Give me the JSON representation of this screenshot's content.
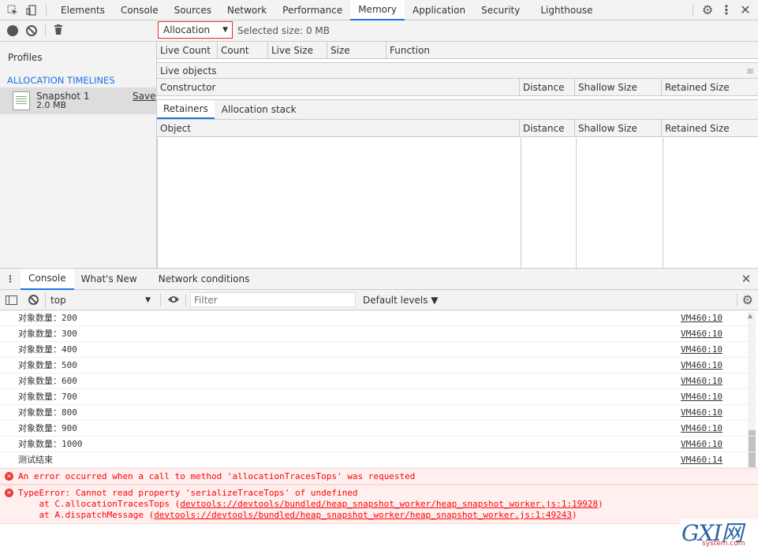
{
  "tabs": [
    "Elements",
    "Console",
    "Sources",
    "Network",
    "Performance",
    "Memory",
    "Application",
    "Security",
    "Lighthouse"
  ],
  "active_tab": "Memory",
  "memory_toolbar": {
    "dropdown": "Allocation",
    "selected_size": "Selected size: 0 MB"
  },
  "sidebar": {
    "profiles_label": "Profiles",
    "section": "ALLOCATION TIMELINES",
    "snapshot_name": "Snapshot 1",
    "snapshot_size": "2.0 MB",
    "save_label": "Save"
  },
  "top_grid": {
    "columns": [
      "Live Count",
      "Count",
      "Live Size",
      "Size",
      "Function"
    ]
  },
  "live_objects": {
    "title": "Live objects",
    "columns": [
      "Constructor",
      "Distance",
      "Shallow Size",
      "Retained Size"
    ]
  },
  "retainers": {
    "tabs": [
      "Retainers",
      "Allocation stack"
    ],
    "columns": [
      "Object",
      "Distance",
      "Shallow Size",
      "Retained Size"
    ]
  },
  "drawer": {
    "tabs": [
      "Console",
      "What's New",
      "Network conditions"
    ]
  },
  "console_toolbar": {
    "context": "top",
    "filter_placeholder": "Filter",
    "levels": "Default levels ▼"
  },
  "messages": [
    {
      "text": "对象数量：200",
      "src": "VM460:10"
    },
    {
      "text": "对象数量：300",
      "src": "VM460:10"
    },
    {
      "text": "对象数量：400",
      "src": "VM460:10"
    },
    {
      "text": "对象数量：500",
      "src": "VM460:10"
    },
    {
      "text": "对象数量：600",
      "src": "VM460:10"
    },
    {
      "text": "对象数量：700",
      "src": "VM460:10"
    },
    {
      "text": "对象数量：800",
      "src": "VM460:10"
    },
    {
      "text": "对象数量：900",
      "src": "VM460:10"
    },
    {
      "text": "对象数量：1000",
      "src": "VM460:10"
    },
    {
      "text": "测试结束",
      "src": "VM460:14"
    }
  ],
  "errors": {
    "error1": "An error occurred when a call to method 'allocationTracesTops' was requested",
    "error2_line1": "TypeError: Cannot read property 'serializeTraceTops' of undefined",
    "error2_line2_prefix": "    at C.allocationTracesTops (",
    "error2_line2_link": "devtools://devtools/bundled/heap_snapshot_worker/heap_snapshot_worker.js:1:19928",
    "error2_line3_prefix": "    at A.dispatchMessage (",
    "error2_line3_link": "devtools://devtools/bundled/heap_snapshot_worker/heap_snapshot_worker.js:1:49243",
    "close_paren": ")"
  },
  "prompt": "›",
  "watermark": {
    "brand": "GXI网",
    "sub": "system.com"
  }
}
